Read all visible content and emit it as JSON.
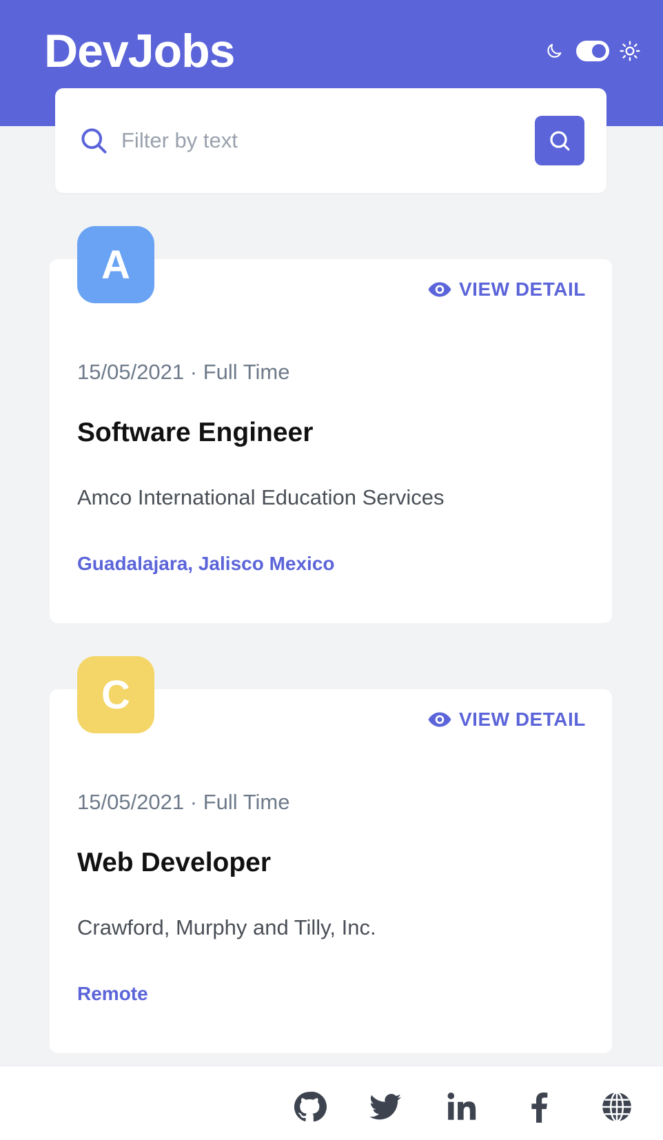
{
  "app": {
    "title": "DevJobs"
  },
  "theme": {
    "mode_icons": [
      "moon-icon",
      "sun-icon"
    ],
    "dark_enabled": true
  },
  "search": {
    "placeholder": "Filter by text"
  },
  "jobs": [
    {
      "initial": "A",
      "avatar_color": "#6aa3f3",
      "view_label": "VIEW DETAIL",
      "meta": "15/05/2021 · Full Time",
      "title": "Software Engineer",
      "company": "Amco International Education Services",
      "location": "Guadalajara, Jalisco Mexico"
    },
    {
      "initial": "C",
      "avatar_color": "#f4d567",
      "view_label": "VIEW DETAIL",
      "meta": "15/05/2021 · Full Time",
      "title": "Web Developer",
      "company": "Crawford, Murphy and Tilly, Inc.",
      "location": "Remote"
    }
  ],
  "footer": {
    "icons": [
      "github-icon",
      "twitter-icon",
      "linkedin-icon",
      "facebook-icon",
      "globe-icon"
    ]
  },
  "colors": {
    "accent": "#5b64d9",
    "background": "#f2f3f5",
    "muted_text": "#6e7a8a",
    "footer_icon": "#3d4450"
  }
}
